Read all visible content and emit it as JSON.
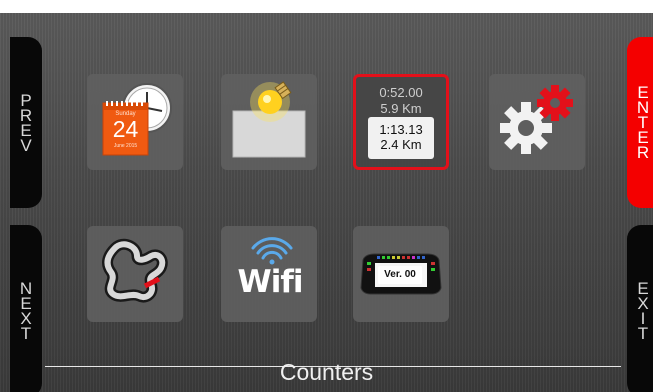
{
  "side_buttons": {
    "prev_letters": [
      "P",
      "R",
      "E",
      "V"
    ],
    "next_letters": [
      "N",
      "E",
      "X",
      "T"
    ],
    "enter_letters": [
      "E",
      "N",
      "T",
      "E",
      "R"
    ],
    "exit_letters": [
      "E",
      "X",
      "I",
      "T"
    ]
  },
  "tiles": {
    "calendar": {
      "day": "24",
      "month": "Sunday",
      "footer": "June 2015",
      "icon": "calendar-clock-icon"
    },
    "brightness": {
      "icon": "light-bulb-icon"
    },
    "laps": {
      "top_time": "0:52.00",
      "top_distance": "5.9 Km",
      "lap_time": "1:13.13",
      "lap_distance": "2.4 Km",
      "icon": "lap-counter-icon"
    },
    "settings": {
      "icon": "gears-icon"
    },
    "track": {
      "icon": "race-track-icon"
    },
    "wifi": {
      "label": "Wifi",
      "icon": "wifi-icon"
    },
    "version": {
      "label": "Ver. 00",
      "icon": "dashboard-device-icon"
    }
  },
  "footer": {
    "label": "Counters"
  },
  "colors": {
    "accent": "#e3101a",
    "enter_button": "#f40000",
    "background": "#4a4a4a"
  }
}
